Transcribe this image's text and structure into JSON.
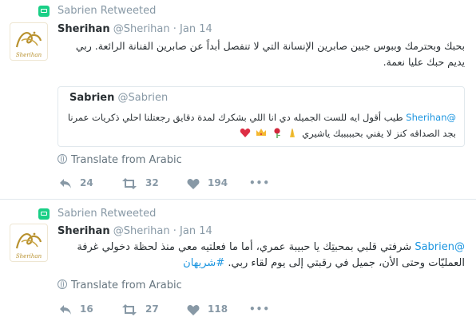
{
  "tweets": [
    {
      "retweet_label": "Sabrien Retweeted",
      "name": "Sherihan",
      "handle": "@Sherihan",
      "dot": "·",
      "time": "Jan 14",
      "avatar_text": "Sherihan",
      "text": "بحبك وبحترمك وببوس جبين صابرين الإنسانة التي لا تنفصل أبداً عن صابرين الفنانة الرائعة. ربي يديم حبك عليا نعمة.",
      "quote": {
        "name": "Sabrien",
        "handle": "@Sabrien",
        "mention": "@Sherihan",
        "text": "طيب أقول ايه للست الجميله دي انا اللي بشكرك لمدة دقايق رجعتلنا احلي ذكريات عمرنا بجد الصداقه كنز لا يفني بحبببببك ياشيري"
      },
      "translate": "Translate from Arabic",
      "reply_count": "24",
      "retweet_count": "32",
      "like_count": "194",
      "more": "•••"
    },
    {
      "retweet_label": "Sabrien Retweeted",
      "name": "Sherihan",
      "handle": "@Sherihan",
      "dot": "·",
      "time": "Jan 14",
      "avatar_text": "Sherihan",
      "mention": "@Sabrien",
      "text_line1": "شرفتي قلبي بمحبتِك يا حبيبة عمري، أما ما فعلتيه معي منذ لحظة دخولي غرفة",
      "text_line2": "العمليّات وحتى الأن، جميل في رقبتي إلى يوم لقاء ربي.",
      "hashtag": "#شريهان",
      "translate": "Translate from Arabic",
      "reply_count": "16",
      "retweet_count": "27",
      "like_count": "118",
      "more": "•••"
    }
  ],
  "colors": {
    "retweet_green": "#19cf86",
    "link_blue": "#1b95e0",
    "muted": "#8899a6",
    "heart_red": "#e0245e"
  }
}
